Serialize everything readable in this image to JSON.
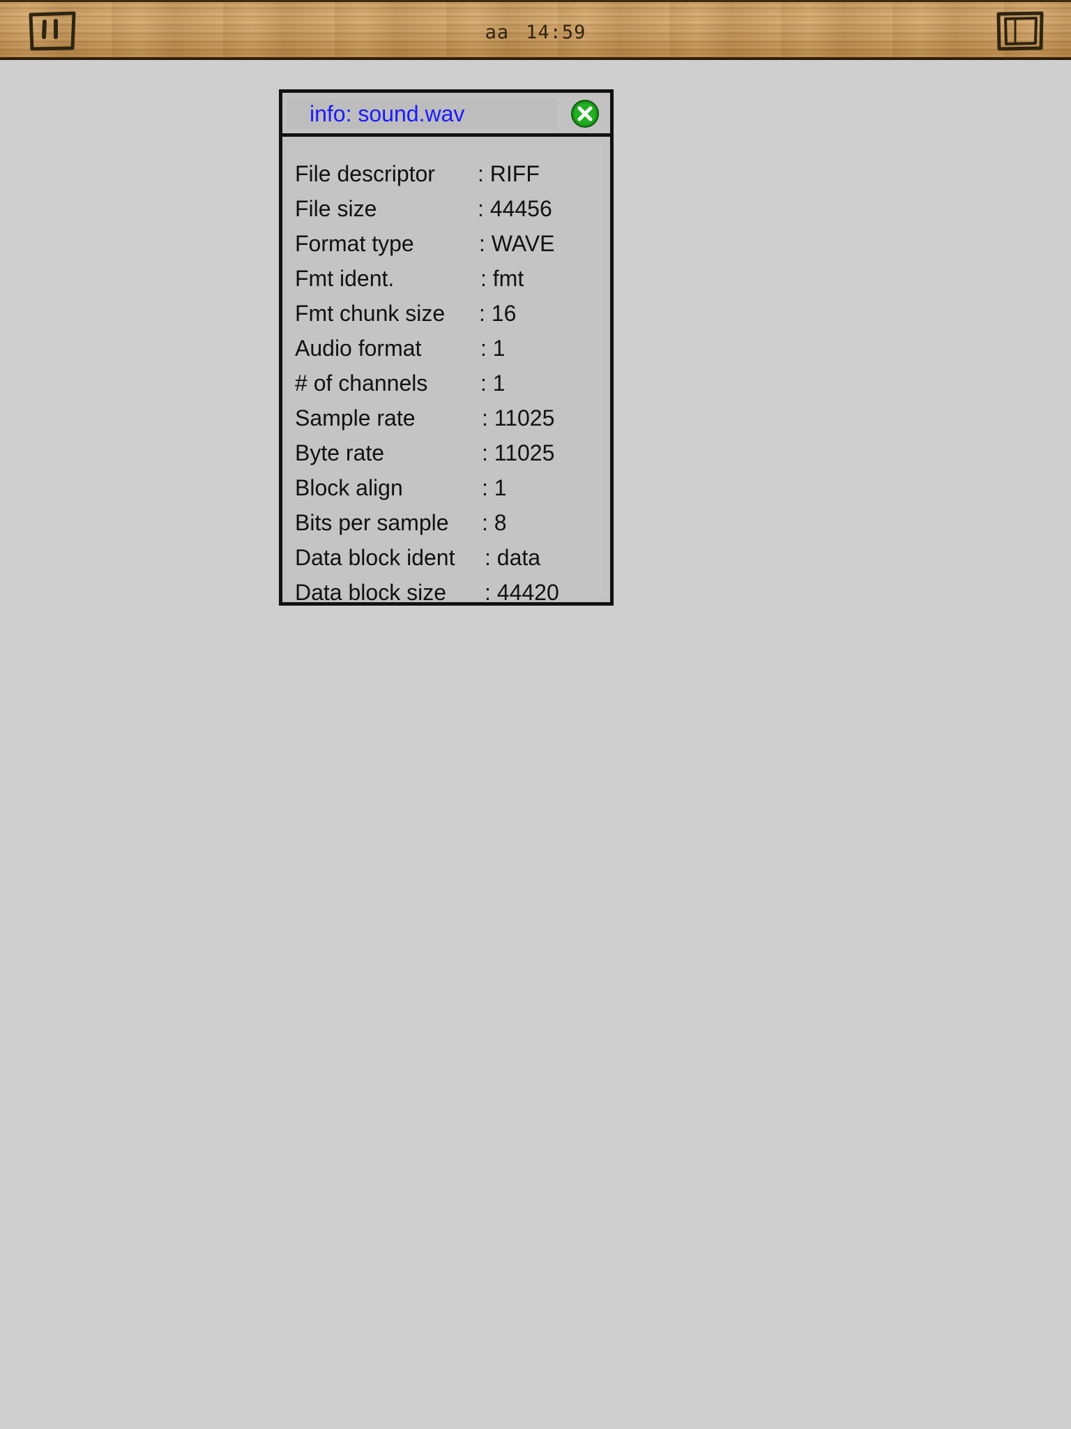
{
  "toolbar": {
    "left_button_icon": "pause-icon",
    "right_button_icon": "window-frame-icon",
    "user": "aa",
    "time": "14:59"
  },
  "dialog": {
    "title": "info: sound.wav",
    "close_icon": "close-icon",
    "close_color": "#1a9e1a",
    "title_color": "#1a1aff",
    "rows": [
      {
        "label": "File descriptor",
        "value": ": RIFF"
      },
      {
        "label": "File size",
        "value": ": 44456"
      },
      {
        "label": "Format type",
        "value": ": WAVE"
      },
      {
        "label": "Fmt ident.",
        "value": ": fmt"
      },
      {
        "label": "Fmt chunk size",
        "value": ": 16"
      },
      {
        "label": "Audio format",
        "value": ": 1"
      },
      {
        "label": "# of channels",
        "value": ": 1"
      },
      {
        "label": "Sample rate",
        "value": ": 11025"
      },
      {
        "label": "Byte rate",
        "value": ": 11025"
      },
      {
        "label": "Block align",
        "value": ": 1"
      },
      {
        "label": "Bits per sample",
        "value": ": 8"
      },
      {
        "label": "Data block ident",
        "value": ": data"
      },
      {
        "label": "Data block size",
        "value": ": 44420"
      }
    ]
  }
}
